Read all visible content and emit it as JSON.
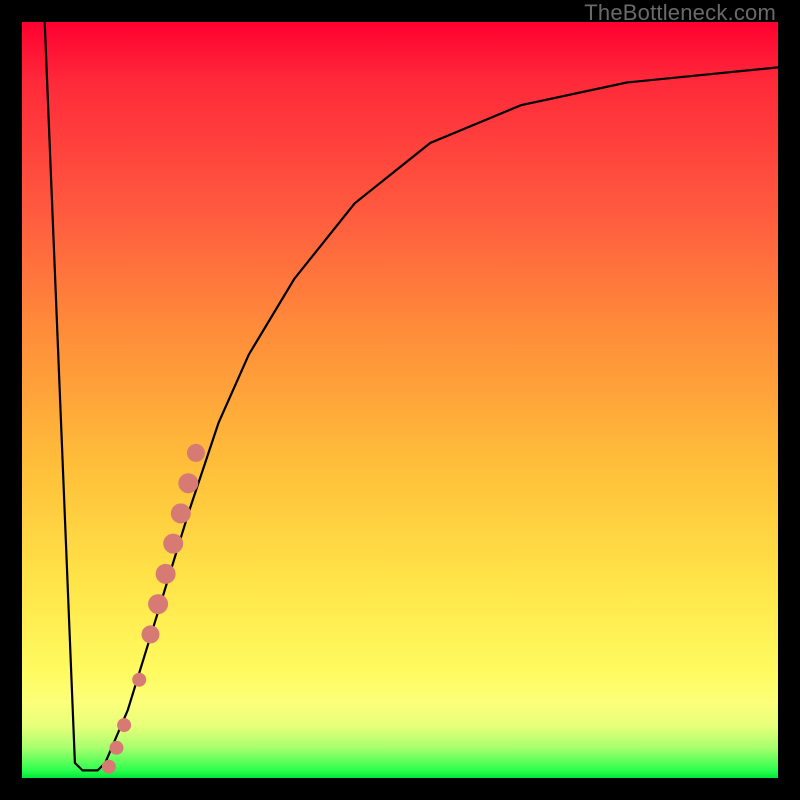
{
  "watermark": "TheBottleneck.com",
  "chart_data": {
    "type": "line",
    "title": "",
    "xlabel": "",
    "ylabel": "",
    "xlim": [
      0,
      100
    ],
    "ylim": [
      0,
      100
    ],
    "grid": false,
    "gradient_stops": [
      {
        "pos": 0,
        "color": "#ff0030"
      },
      {
        "pos": 8,
        "color": "#ff2a3a"
      },
      {
        "pos": 25,
        "color": "#ff5a3f"
      },
      {
        "pos": 40,
        "color": "#ff8a3a"
      },
      {
        "pos": 60,
        "color": "#ffc23a"
      },
      {
        "pos": 75,
        "color": "#ffe64a"
      },
      {
        "pos": 86,
        "color": "#fffb60"
      },
      {
        "pos": 90,
        "color": "#fcff7a"
      },
      {
        "pos": 93,
        "color": "#e8ff7a"
      },
      {
        "pos": 96,
        "color": "#a8ff6e"
      },
      {
        "pos": 99,
        "color": "#2cff4e"
      },
      {
        "pos": 100,
        "color": "#00e63a"
      }
    ],
    "series": [
      {
        "name": "bottleneck-curve",
        "x": [
          3,
          7,
          8,
          9,
          10,
          11,
          14,
          18,
          22,
          26,
          30,
          36,
          44,
          54,
          66,
          80,
          100
        ],
        "y": [
          100,
          2,
          1,
          1,
          1,
          2,
          9,
          22,
          35,
          47,
          56,
          66,
          76,
          84,
          89,
          92,
          94
        ]
      }
    ],
    "points": {
      "name": "highlighted-segment",
      "color": "#d77a74",
      "x": [
        11.5,
        12.5,
        13.5,
        15.5,
        17.0,
        18.0,
        19.0,
        20.0,
        21.0,
        22.0,
        23.0
      ],
      "y": [
        1.5,
        4.0,
        7.0,
        13.0,
        19.0,
        23.0,
        27.0,
        31.0,
        35.0,
        39.0,
        43.0
      ],
      "r": [
        7,
        7,
        7,
        7,
        9,
        10,
        10,
        10,
        10,
        10,
        9
      ]
    }
  }
}
